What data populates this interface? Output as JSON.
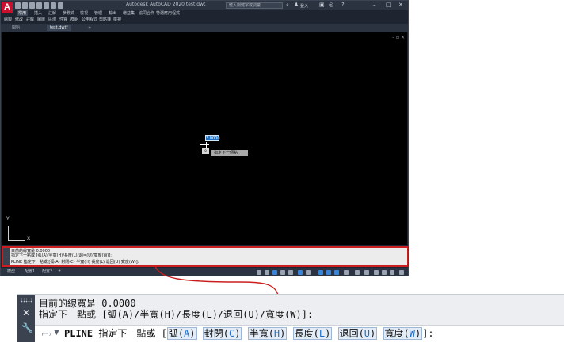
{
  "app": {
    "title": "Autodesk AutoCAD 2020   test.dwt",
    "search_placeholder": "鍵入關鍵字或詞彙",
    "user": "登入"
  },
  "menus": [
    "常用",
    "插入",
    "註解",
    "參數式",
    "檢視",
    "管理",
    "輸出",
    "增益集",
    "協同合作",
    "特選應用程式"
  ],
  "tools": [
    "繪製",
    "修改",
    "註解",
    "圖層",
    "區塊",
    "性質",
    "群組",
    "公用程式",
    "剪貼簿",
    "檢視"
  ],
  "file_tabs": [
    "開始",
    "test.dwt*"
  ],
  "viewport": {
    "coord_value": "3.0000",
    "pick_box": "0",
    "tooltip": "指定下一個點",
    "ucs_y": "Y",
    "ucs_x": "X"
  },
  "command_small": {
    "history": [
      "目前的線寬是 0.0000",
      "指定下一點或 [弧(A)/半寬(H)/長度(L)/退回(U)/寬度(W)]:"
    ],
    "line": "PLINE 指定下一點或 [弧(A) 封閉(C) 半寬(H) 長度(L) 退回(U) 寬度(W)]:"
  },
  "layout_tabs": [
    "模型",
    "配置1",
    "配置2"
  ],
  "command_large": {
    "history": [
      "目前的線寬是 0.0000",
      "指定下一點或 [弧(A)/半寬(H)/長度(L)/退回(U)/寬度(W)]:"
    ],
    "cmd_name": "PLINE",
    "prompt": "指定下一點或 [",
    "options": [
      {
        "label": "弧(",
        "key": "A",
        "end": ")"
      },
      {
        "label": "封閉(",
        "key": "C",
        "end": ")"
      },
      {
        "label": "半寬(",
        "key": "H",
        "end": ")"
      },
      {
        "label": "長度(",
        "key": "L",
        "end": ")"
      },
      {
        "label": "退回(",
        "key": "U",
        "end": ")"
      },
      {
        "label": "寬度(",
        "key": "W",
        "end": ")"
      }
    ],
    "close": "]:"
  },
  "colors": {
    "accent": "#cc1f1f",
    "keyword": "#1e6ec8"
  }
}
